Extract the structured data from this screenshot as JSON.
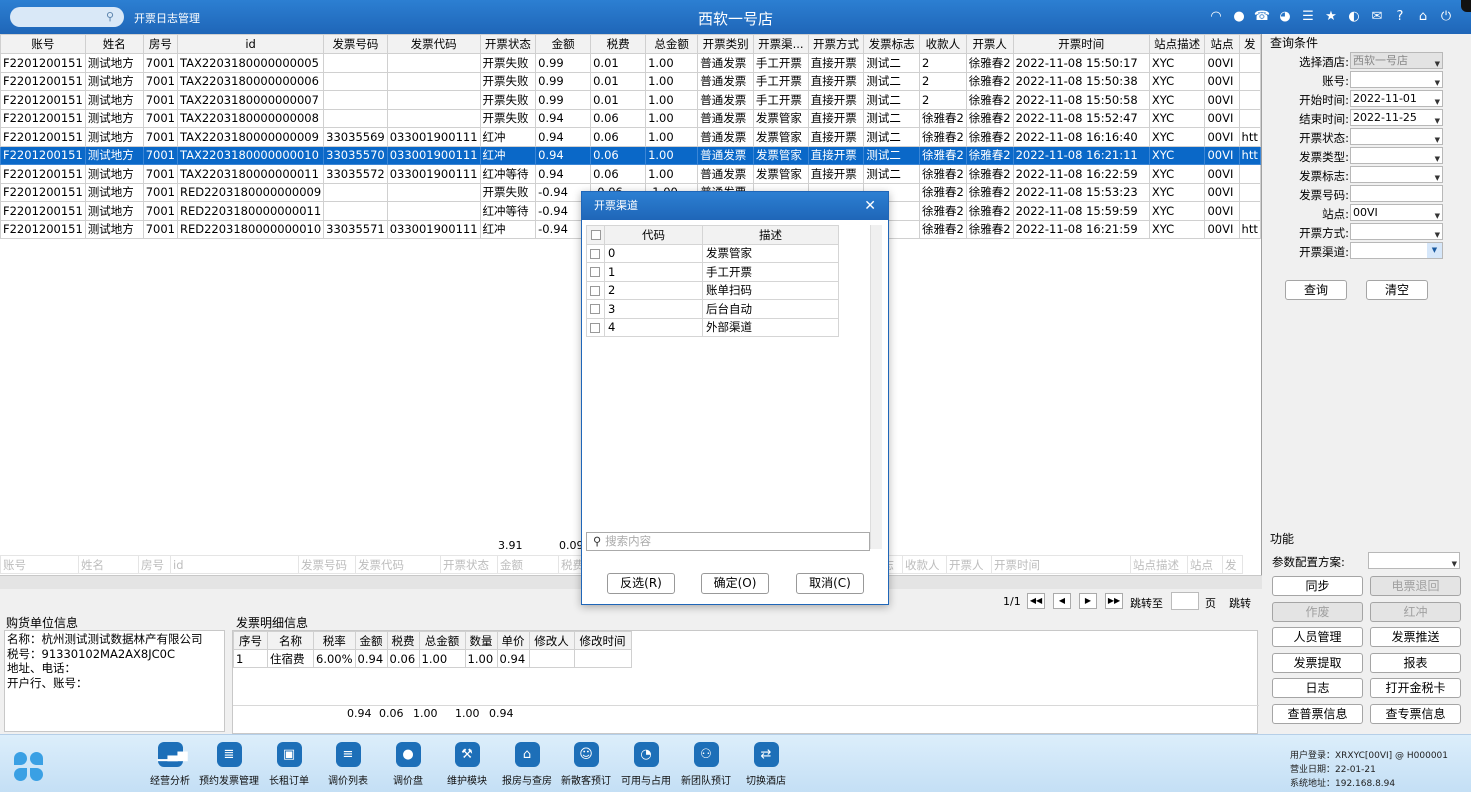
{
  "app": {
    "module_title": "开票日志管理",
    "store_name": "西软一号店"
  },
  "top_icons": [
    "wifi-icon",
    "chat-icon",
    "phone-icon",
    "palette-icon",
    "menu-icon",
    "star-icon",
    "theme-icon",
    "mail-icon",
    "help-icon",
    "home-icon",
    "power-icon"
  ],
  "grid": {
    "columns": [
      "账号",
      "姓名",
      "房号",
      "id",
      "发票号码",
      "发票代码",
      "开票状态",
      "金额",
      "税费",
      "总金额",
      "开票类别",
      "开票渠...",
      "开票方式",
      "发票标志",
      "收款人",
      "开票人",
      "开票时间",
      "站点描述",
      "站点",
      "发"
    ],
    "rows": [
      [
        "F2201200151",
        "测试地方",
        "7001",
        "TAX2203180000000005",
        "",
        "",
        "开票失败",
        "0.99",
        "0.01",
        "1.00",
        "普通发票",
        "手工开票",
        "直接开票",
        "测试二",
        "2",
        "徐雅春2",
        "2022-11-08 15:50:17",
        "XYC",
        "00VI",
        ""
      ],
      [
        "F2201200151",
        "测试地方",
        "7001",
        "TAX2203180000000006",
        "",
        "",
        "开票失败",
        "0.99",
        "0.01",
        "1.00",
        "普通发票",
        "手工开票",
        "直接开票",
        "测试二",
        "2",
        "徐雅春2",
        "2022-11-08 15:50:38",
        "XYC",
        "00VI",
        ""
      ],
      [
        "F2201200151",
        "测试地方",
        "7001",
        "TAX2203180000000007",
        "",
        "",
        "开票失败",
        "0.99",
        "0.01",
        "1.00",
        "普通发票",
        "手工开票",
        "直接开票",
        "测试二",
        "2",
        "徐雅春2",
        "2022-11-08 15:50:58",
        "XYC",
        "00VI",
        ""
      ],
      [
        "F2201200151",
        "测试地方",
        "7001",
        "TAX2203180000000008",
        "",
        "",
        "开票失败",
        "0.94",
        "0.06",
        "1.00",
        "普通发票",
        "发票管家",
        "直接开票",
        "测试二",
        "徐雅春2",
        "徐雅春2",
        "2022-11-08 15:52:47",
        "XYC",
        "00VI",
        ""
      ],
      [
        "F2201200151",
        "测试地方",
        "7001",
        "TAX2203180000000009",
        "33035569",
        "033001900111",
        "红冲",
        "0.94",
        "0.06",
        "1.00",
        "普通发票",
        "发票管家",
        "直接开票",
        "测试二",
        "徐雅春2",
        "徐雅春2",
        "2022-11-08 16:16:40",
        "XYC",
        "00VI",
        "htt"
      ],
      [
        "F2201200151",
        "测试地方",
        "7001",
        "TAX2203180000000010",
        "33035570",
        "033001900111",
        "红冲",
        "0.94",
        "0.06",
        "1.00",
        "普通发票",
        "发票管家",
        "直接开票",
        "测试二",
        "徐雅春2",
        "徐雅春2",
        "2022-11-08 16:21:11",
        "XYC",
        "00VI",
        "htt"
      ],
      [
        "F2201200151",
        "测试地方",
        "7001",
        "TAX2203180000000011",
        "33035572",
        "033001900111",
        "红冲等待",
        "0.94",
        "0.06",
        "1.00",
        "普通发票",
        "发票管家",
        "直接开票",
        "测试二",
        "徐雅春2",
        "徐雅春2",
        "2022-11-08 16:22:59",
        "XYC",
        "00VI",
        ""
      ],
      [
        "F2201200151",
        "测试地方",
        "7001",
        "RED2203180000000009",
        "",
        "",
        "开票失败",
        "-0.94",
        "-0.06",
        "-1.00",
        "普通发票",
        "",
        "",
        "",
        "徐雅春2",
        "徐雅春2",
        "2022-11-08 15:53:23",
        "XYC",
        "00VI",
        ""
      ],
      [
        "F2201200151",
        "测试地方",
        "7001",
        "RED2203180000000011",
        "",
        "",
        "红冲等待",
        "-0.94",
        "-0.06",
        "",
        "",
        "",
        "",
        "",
        "徐雅春2",
        "徐雅春2",
        "2022-11-08 15:59:59",
        "XYC",
        "00VI",
        ""
      ],
      [
        "F2201200151",
        "测试地方",
        "7001",
        "RED2203180000000010",
        "33035571",
        "033001900111",
        "红冲",
        "-0.94",
        "-0.06",
        "",
        "",
        "",
        "",
        "",
        "徐雅春2",
        "徐雅春2",
        "2022-11-08 16:21:59",
        "XYC",
        "00VI",
        "htt"
      ]
    ],
    "selected_row": 5,
    "sum_amount": "3.91",
    "sum_tax": "0.09"
  },
  "pager": {
    "page": "1/1",
    "jump_label": "跳转至",
    "page_unit": "页",
    "jump_button": "跳转"
  },
  "query": {
    "title": "查询条件",
    "fields": [
      {
        "label": "选择酒店:",
        "value": "西软一号店",
        "disabled": true
      },
      {
        "label": "账号:",
        "value": ""
      },
      {
        "label": "开始时间:",
        "value": "2022-11-01"
      },
      {
        "label": "结束时间:",
        "value": "2022-11-25"
      },
      {
        "label": "开票状态:",
        "value": ""
      },
      {
        "label": "发票类型:",
        "value": ""
      },
      {
        "label": "发票标志:",
        "value": ""
      },
      {
        "label": "发票号码:",
        "value": "",
        "text": true
      },
      {
        "label": "站点:",
        "value": "00VI"
      },
      {
        "label": "开票方式:",
        "value": ""
      },
      {
        "label": "开票渠道:",
        "value": "",
        "active": true
      }
    ],
    "search_button": "查询",
    "clear_button": "清空"
  },
  "functions": {
    "title": "功能",
    "config_label": "参数配置方案:",
    "buttons": [
      {
        "label": "同步",
        "disabled": false
      },
      {
        "label": "电票退回",
        "disabled": true
      },
      {
        "label": "作废",
        "disabled": true
      },
      {
        "label": "红冲",
        "disabled": true
      },
      {
        "label": "人员管理",
        "disabled": false
      },
      {
        "label": "发票推送",
        "disabled": false
      },
      {
        "label": "发票提取",
        "disabled": false
      },
      {
        "label": "报表",
        "disabled": false
      },
      {
        "label": "日志",
        "disabled": false
      },
      {
        "label": "打开金税卡",
        "disabled": false
      },
      {
        "label": "查普票信息",
        "disabled": false
      },
      {
        "label": "查专票信息",
        "disabled": false
      }
    ]
  },
  "buyer": {
    "title": "购货单位信息",
    "name": "名称：杭州测试测试数据林产有限公司",
    "tax_no": "税号：91330102MA2AX8JC0C",
    "address": "地址、电话：",
    "bank": "开户行、账号："
  },
  "detail": {
    "title": "发票明细信息",
    "columns": [
      "序号",
      "名称",
      "税率",
      "金额",
      "税费",
      "总金额",
      "数量",
      "单价",
      "修改人",
      "修改时间"
    ],
    "rows": [
      [
        "1",
        "住宿费",
        "6.00%",
        "0.94",
        "0.06",
        "1.00",
        "1.00",
        "0.94",
        "",
        ""
      ]
    ],
    "sums": [
      "0.94",
      "0.06",
      "1.00",
      "1.00",
      "0.94"
    ]
  },
  "modal": {
    "title": "开票渠道",
    "columns": [
      "代码",
      "描述"
    ],
    "rows": [
      [
        "0",
        "发票管家"
      ],
      [
        "1",
        "手工开票"
      ],
      [
        "2",
        "账单扫码"
      ],
      [
        "3",
        "后台自动"
      ],
      [
        "4",
        "外部渠道"
      ]
    ],
    "search_placeholder": "搜索内容",
    "invert_button": "反选(R)",
    "ok_button": "确定(O)",
    "cancel_button": "取消(C)"
  },
  "taskbar": [
    {
      "label": "经营分析",
      "icon": "chart-icon"
    },
    {
      "label": "预约发票管理",
      "icon": "invoice-icon"
    },
    {
      "label": "长租订单",
      "icon": "briefcase-icon"
    },
    {
      "label": "调价列表",
      "icon": "list-icon"
    },
    {
      "label": "调价盘",
      "icon": "money-bag-icon"
    },
    {
      "label": "维护模块",
      "icon": "wrench-icon"
    },
    {
      "label": "报房与查房",
      "icon": "house-icon"
    },
    {
      "label": "新散客预订",
      "icon": "user-add-icon"
    },
    {
      "label": "可用与占用",
      "icon": "pie-icon"
    },
    {
      "label": "新团队预订",
      "icon": "group-icon"
    },
    {
      "label": "切换酒店",
      "icon": "switch-icon"
    }
  ],
  "status": {
    "login": "用户登录：XRXYC[00VI] @ H000001",
    "biz_date": "营业日期：22-01-21",
    "sys_addr": "系统地址：192.168.8.94"
  }
}
